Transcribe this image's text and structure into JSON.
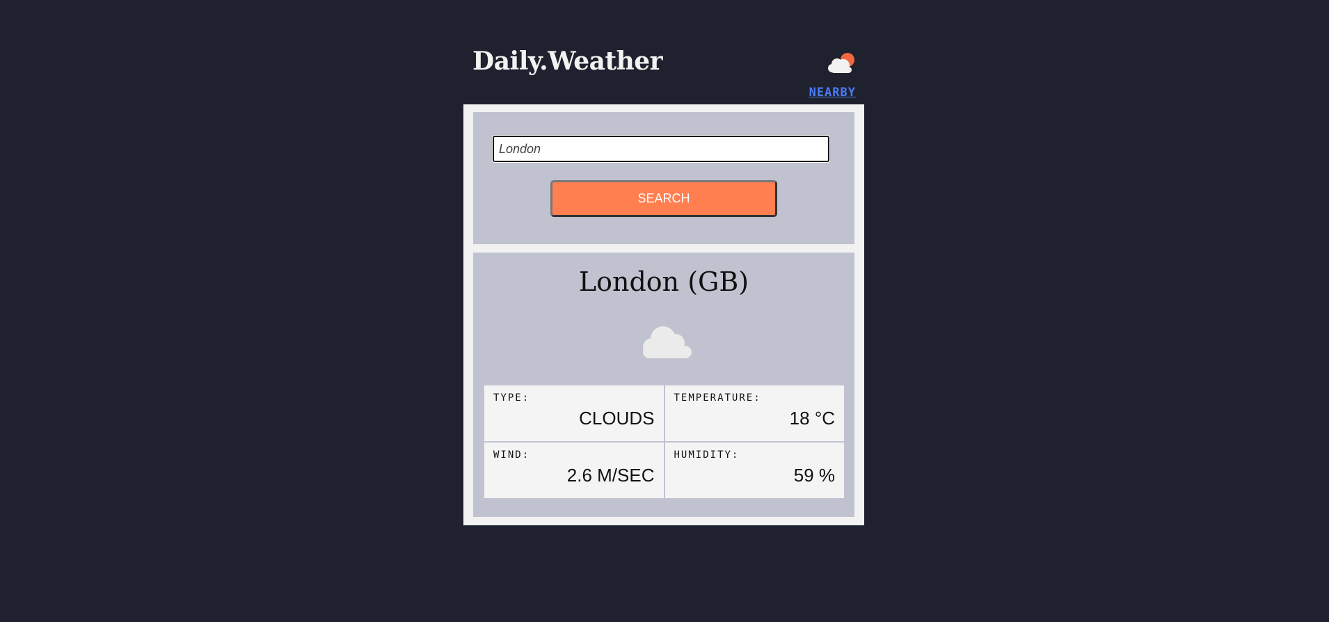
{
  "header": {
    "logo_text": "Daily.Weather",
    "logo_icon": "sun-behind-cloud-icon",
    "nearby_label": "NEARBY"
  },
  "search": {
    "value": "London",
    "button_label": "SEARCH"
  },
  "result": {
    "city": "London (GB)",
    "weather_icon": "cloud-icon",
    "stats": [
      {
        "label": "TYPE:",
        "value": "CLOUDS"
      },
      {
        "label": "TEMPERATURE:",
        "value": "18 °C"
      },
      {
        "label": "WIND:",
        "value": "2.6 M/SEC"
      },
      {
        "label": "HUMIDITY:",
        "value": "59 %"
      }
    ]
  },
  "colors": {
    "background": "#1f212e",
    "panel": "#c0c2d0",
    "accent": "#ff7f50",
    "link": "#4a7df7"
  }
}
